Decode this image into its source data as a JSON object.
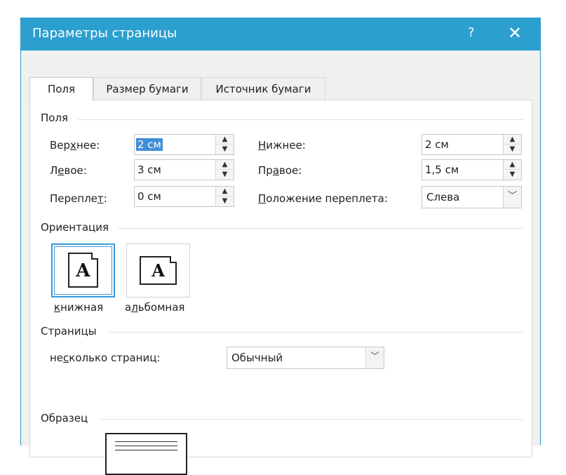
{
  "titlebar": {
    "title": "Параметры страницы",
    "help": "?",
    "close": "✕"
  },
  "tabs": [
    {
      "label": "Поля"
    },
    {
      "label": "Размер бумаги"
    },
    {
      "label": "Источник бумаги"
    }
  ],
  "margins": {
    "group_title": "Поля",
    "top_label": "Верхнее:",
    "top_value": "2 см",
    "bottom_label": "Нижнее:",
    "bottom_value": "2 см",
    "left_label": "Левое:",
    "left_value": "3 см",
    "right_label": "Правое:",
    "right_value": "1,5 см",
    "gutter_label": "Переплет:",
    "gutter_value": "0 см",
    "gutter_pos_label": "Положение переплета:",
    "gutter_pos_value": "Слева"
  },
  "orientation": {
    "group_title": "Ориентация",
    "portrait_label": "книжная",
    "landscape_label": "альбомная",
    "icon_letter": "A",
    "selected": "portrait"
  },
  "pages": {
    "group_title": "Страницы",
    "multiple_label": "несколько страниц:",
    "multiple_value": "Обычный"
  },
  "preview": {
    "group_title": "Образец"
  },
  "colors": {
    "titlebar": "#2b9fce",
    "selection": "#3f8fd8",
    "focus": "#3a98d8"
  }
}
